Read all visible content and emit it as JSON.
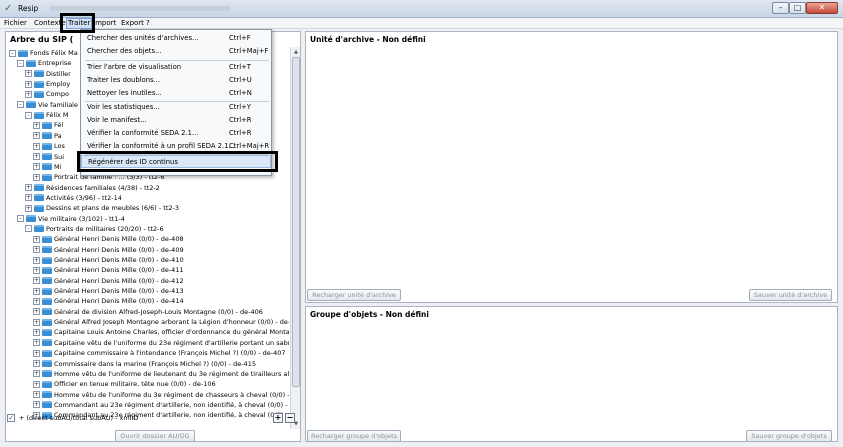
{
  "window": {
    "title": "Resip"
  },
  "menu": {
    "items": [
      "Fichier",
      "Contexte",
      "Traiter",
      "Import",
      "Export",
      "?"
    ]
  },
  "left_panel": {
    "title": "Arbre du SIP (",
    "tree": [
      {
        "indent": 0,
        "exp": "-",
        "text": "Fonds Félix Ma"
      },
      {
        "indent": 1,
        "exp": "-",
        "text": "Entreprise"
      },
      {
        "indent": 2,
        "exp": "+",
        "text": "Distiller"
      },
      {
        "indent": 2,
        "exp": "+",
        "text": "Employ"
      },
      {
        "indent": 2,
        "exp": "+",
        "text": "Compo"
      },
      {
        "indent": 1,
        "exp": "-",
        "text": "Vie familiale"
      },
      {
        "indent": 2,
        "exp": "-",
        "text": "Félix M"
      },
      {
        "indent": 3,
        "exp": "+",
        "text": "Fél"
      },
      {
        "indent": 3,
        "exp": "+",
        "text": "Pa"
      },
      {
        "indent": 3,
        "exp": "+",
        "text": "Los"
      },
      {
        "indent": 3,
        "exp": "+",
        "text": "Sui"
      },
      {
        "indent": 3,
        "exp": "+",
        "text": "Mi"
      },
      {
        "indent": 3,
        "exp": "+",
        "text": "Portrait de famille : ... (3/3) - tt2-6"
      },
      {
        "indent": 2,
        "exp": "+",
        "text": "Résidences familiales (4/38) - tt2-2"
      },
      {
        "indent": 2,
        "exp": "+",
        "text": "Activités (3/96) - tt2-14"
      },
      {
        "indent": 2,
        "exp": "+",
        "text": "Dessins et plans de meubles (6/6) - tt2-3"
      },
      {
        "indent": 1,
        "exp": "-",
        "text": "Vie militaire (3/102) - tt1-4"
      },
      {
        "indent": 2,
        "exp": "-",
        "text": "Portraits de militaires (20/20) - tt2-6"
      },
      {
        "indent": 3,
        "exp": "+",
        "text": "Général Henri Denis Mille (0/0) - de-408"
      },
      {
        "indent": 3,
        "exp": "+",
        "text": "Général Henri Denis Mille (0/0) - de-409"
      },
      {
        "indent": 3,
        "exp": "+",
        "text": "Général Henri Denis Mille (0/0) - de-410"
      },
      {
        "indent": 3,
        "exp": "+",
        "text": "Général Henri Denis Mille (0/0) - de-411"
      },
      {
        "indent": 3,
        "exp": "+",
        "text": "Général Henri Denis Mille (0/0) - de-412"
      },
      {
        "indent": 3,
        "exp": "+",
        "text": "Général Henri Denis Mille (0/0) - de-413"
      },
      {
        "indent": 3,
        "exp": "+",
        "text": "Général Henri Denis Mille (0/0) - de-414"
      },
      {
        "indent": 3,
        "exp": "+",
        "text": "Général de division Alfred-Joseph-Louis Montagne (0/0) - de-406"
      },
      {
        "indent": 3,
        "exp": "+",
        "text": "Général Alfred Joseph Montagne arborant la Légion d'honneur (0/0) - de-156"
      },
      {
        "indent": 3,
        "exp": "+",
        "text": "Capitaine Louis Antoine Charles, officier d'ordonnance du général Montagne cc"
      },
      {
        "indent": 3,
        "exp": "+",
        "text": "Capitaine vêtu de l'uniforme du 23e régiment d'artillerie portant un sabre (0/0)"
      },
      {
        "indent": 3,
        "exp": "+",
        "text": "Capitaine commissaire à l'intendance (François Michel ?) (0/0) - de-407"
      },
      {
        "indent": 3,
        "exp": "+",
        "text": "Commissaire dans la marine (François Michel ?) (0/0) - de-415"
      },
      {
        "indent": 3,
        "exp": "+",
        "text": "Homme vêtu de l'uniforme de lieutenant du 3e régiment de tirailleurs algériens"
      },
      {
        "indent": 3,
        "exp": "+",
        "text": "Officier en tenue militaire, tête nue (0/0) - de-106"
      },
      {
        "indent": 3,
        "exp": "+",
        "text": "Homme vêtu de l'uniforme du 3e régiment de chasseurs à cheval (0/0) - de-10-"
      },
      {
        "indent": 3,
        "exp": "+",
        "text": "Commandant au 23e régiment d'artillerie, non identifié, à cheval (0/0) - de-159"
      },
      {
        "indent": 3,
        "exp": "+",
        "text": "Commandant au 23e régiment d'artillerie, non identifié, à cheval (0/0) - de-160"
      }
    ],
    "checkbox_label": "+ (direct subAU/total subAU) - xmlID",
    "open_folder_button": "Ouvrir dossier AU/OG"
  },
  "archive_unit_panel": {
    "title": "Unité d'archive - Non défini",
    "reload_button": "Recharger unité d'archive",
    "save_button": "Sauver unité d'archive"
  },
  "object_group_panel": {
    "title": "Groupe d'objets - Non défini",
    "reload_button": "Recharger groupe d'objets",
    "save_button": "Sauver groupe d'objets"
  },
  "dropdown": {
    "items": [
      {
        "label": "Chercher des unités d'archives...",
        "key": "Ctrl+F"
      },
      {
        "label": "Chercher des objets...",
        "key": "Ctrl+Maj+F"
      },
      {
        "label": "Trier l'arbre de visualisation",
        "key": "Ctrl+T"
      },
      {
        "label": "Traiter les doublons...",
        "key": "Ctrl+U"
      },
      {
        "label": "Nettoyer les inutiles...",
        "key": "Ctrl+N"
      },
      {
        "label": "Voir les statistiques...",
        "key": "Ctrl+Y"
      },
      {
        "label": "Voir le manifest...",
        "key": "Ctrl+R"
      },
      {
        "label": "Vérifier la conformité SEDA 2.1...",
        "key": "Ctrl+R"
      },
      {
        "label": "Vérifier la conformité à un profil SEDA 2.1...",
        "key": "Ctrl+Maj+R"
      },
      {
        "label": "Régénérer des ID continus",
        "key": ""
      }
    ]
  }
}
